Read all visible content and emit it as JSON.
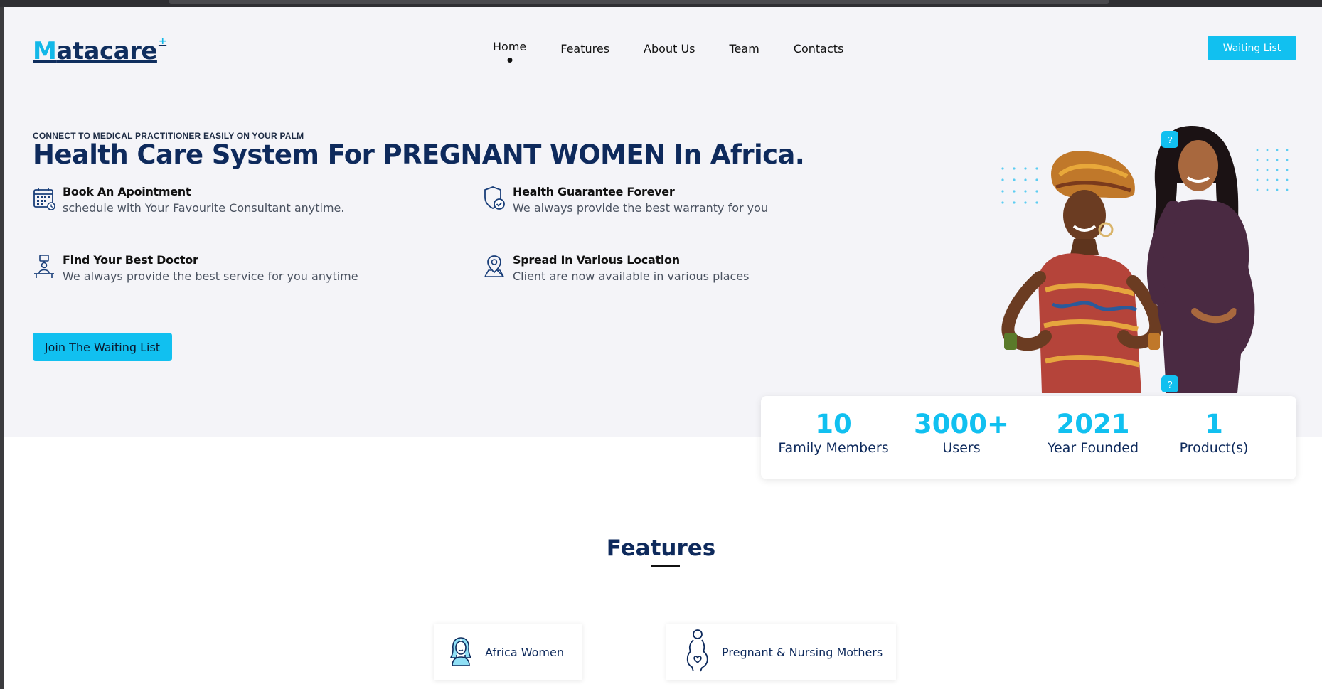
{
  "brand": {
    "logo_text": "Matacare",
    "logo_plus": "+",
    "colors": {
      "primary": "#11c0f0",
      "navy": "#0e2a5c",
      "hero_bg": "#f4f4f8"
    }
  },
  "nav": {
    "items": [
      {
        "label": "Home",
        "active": true
      },
      {
        "label": "Features"
      },
      {
        "label": "About Us"
      },
      {
        "label": "Team"
      },
      {
        "label": "Contacts"
      }
    ],
    "cta_label": "Waiting List"
  },
  "hero": {
    "eyebrow": "CONNECT TO MEDICAL PRACTITIONER EASILY ON YOUR PALM",
    "headline": "Health Care System For PREGNANT WOMEN In Africa.",
    "features": [
      {
        "icon": "calendar-icon",
        "title": "Book An Apointment",
        "desc": "schedule with Your Favourite Consultant anytime."
      },
      {
        "icon": "shield-check-icon",
        "title": "Health Guarantee Forever",
        "desc": "We always provide the best warranty for you"
      },
      {
        "icon": "doctor-desk-icon",
        "title": "Find Your Best Doctor",
        "desc": "We always provide the best service for you anytime"
      },
      {
        "icon": "map-pin-icon",
        "title": "Spread In Various Location",
        "desc": "Client are now available in various places"
      }
    ],
    "join_label": "Join The Waiting List",
    "image": {
      "icon": "hero-women-illustration"
    }
  },
  "stats": [
    {
      "value": "10",
      "label": "Family Members"
    },
    {
      "value": "3000+",
      "label": "Users"
    },
    {
      "value": "2021",
      "label": "Year Founded"
    },
    {
      "value": "1",
      "label": "Product(s)"
    }
  ],
  "features_section": {
    "title": "Features",
    "cards": [
      {
        "icon": "woman-icon",
        "label": "Africa Women"
      },
      {
        "icon": "pregnant-icon",
        "label": "Pregnant & Nursing Mothers"
      }
    ]
  }
}
